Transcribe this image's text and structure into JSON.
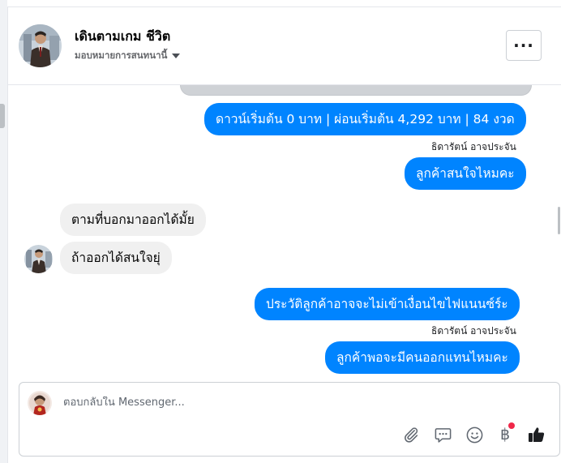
{
  "header": {
    "contact_name": "เดินตามเกม ชีวิต",
    "assign_label": "มอบหมายการสนทนานี้",
    "more_label": "···"
  },
  "messages": [
    {
      "direction": "out",
      "text": "ดาวน์เริ่มต้น 0 บาท | ผ่อนเริ่มต้น 4,292 บาท | 84 งวด",
      "sender": "ธิดารัตน์ อาจประจัน"
    },
    {
      "direction": "out",
      "text": "ลูกค้าสนใจไหมคะ"
    },
    {
      "direction": "in",
      "text": "ตามที่บอกมาออกได้มั้ย"
    },
    {
      "direction": "in",
      "text": "ถ้าออกได้สนใจยุ่"
    },
    {
      "direction": "out",
      "text": "ประวัติลูกค้าอาจจะไม่เข้าเงื่อนไขไฟแนนซ์ร์ะ",
      "sender": "ธิดารัตน์ อาจประจัน"
    },
    {
      "direction": "out",
      "text": "ลูกค้าพอจะมีคนออกแทนไหมคะ"
    }
  ],
  "composer": {
    "placeholder": "ตอบกลับใน Messenger...",
    "currency_symbol": "฿",
    "tools": [
      "paperclip-icon",
      "saved-replies-icon",
      "emoji-icon",
      "payment-icon",
      "thumbs-up-icon"
    ]
  },
  "colors": {
    "outgoing_bubble": "#0084ff",
    "incoming_bubble": "#f0f0f0",
    "notification_dot": "#f02849"
  }
}
